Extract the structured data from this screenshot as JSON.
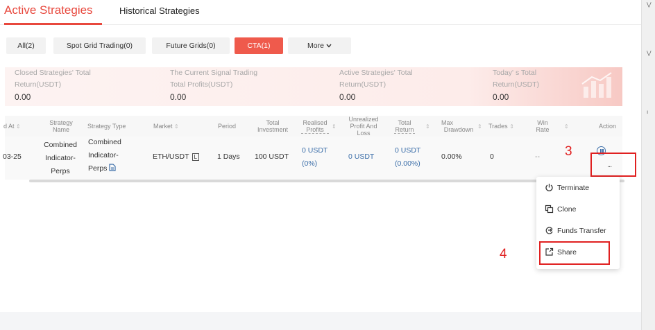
{
  "tabs": {
    "active": "Active Strategies",
    "historical": "Historical Strategies"
  },
  "filters": [
    {
      "label": "All(2)"
    },
    {
      "label": "Spot Grid Trading(0)"
    },
    {
      "label": "Future Grids(0)"
    },
    {
      "label": "CTA(1)"
    },
    {
      "label": "More"
    }
  ],
  "summary": {
    "closed": {
      "line1": "Closed Strategies'   Total",
      "line2": "Return(USDT)",
      "value": "0.00"
    },
    "signal": {
      "line1": "The Current Signal Trading",
      "line2": "Total Profits(USDT)",
      "value": "0.00"
    },
    "active": {
      "line1": "Active Strategies'   Total",
      "line2": "Return(USDT)",
      "value": "0.00"
    },
    "today": {
      "line1": "Today'  s Total",
      "line2": "Return(USDT)",
      "value": "0.00"
    }
  },
  "columns": {
    "created": "d At",
    "name_1": "Strategy",
    "name_2": "Name",
    "type": "Strategy Type",
    "market": "Market",
    "period": "Period",
    "investment_1": "Total",
    "investment_2": "Investment",
    "realised_1": "Realised",
    "realised_2": "Profits",
    "unrealized_1": "Unrealized",
    "unrealized_2": "Profit And",
    "unrealized_3": "Loss",
    "total_return_1": "Total",
    "total_return_2": "Return",
    "max_dd_1": "Max",
    "max_dd_2": "Drawdown",
    "trades": "Trades",
    "win_1": "Win",
    "win_2": "Rate",
    "action": "Action"
  },
  "row": {
    "created": "03-25",
    "name_1": "Combined",
    "name_2": "Indicator-",
    "name_3": "Perps",
    "type_1": "Combined",
    "type_2": "Indicator-",
    "type_3": "Perps",
    "market": "ETH/USDT",
    "market_badge": "L",
    "period": "1 Days",
    "investment": "100 USDT",
    "realised_1": "0 USDT",
    "realised_2": "(0%)",
    "unrealized": "0 USDT",
    "total_return_1": "0 USDT",
    "total_return_2": "(0.00%)",
    "max_dd": "0.00%",
    "trades": "0",
    "win_rate": "--",
    "more": "..."
  },
  "menu": [
    {
      "label": "Terminate",
      "icon": "power-icon"
    },
    {
      "label": "Clone",
      "icon": "clone-icon"
    },
    {
      "label": "Funds Transfer",
      "icon": "transfer-icon"
    },
    {
      "label": "Share",
      "icon": "share-icon"
    }
  ],
  "annotations": {
    "step3": "3",
    "step4": "4"
  },
  "colors": {
    "accent": "#e8483d",
    "link": "#3a6da8",
    "annotation": "#e02020"
  }
}
